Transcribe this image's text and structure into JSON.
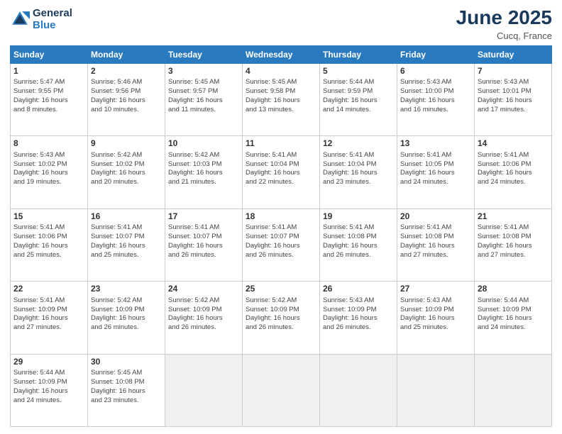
{
  "header": {
    "logo_line1": "General",
    "logo_line2": "Blue",
    "month": "June 2025",
    "location": "Cucq, France"
  },
  "days_of_week": [
    "Sunday",
    "Monday",
    "Tuesday",
    "Wednesday",
    "Thursday",
    "Friday",
    "Saturday"
  ],
  "weeks": [
    [
      {
        "day": "1",
        "info": "Sunrise: 5:47 AM\nSunset: 9:55 PM\nDaylight: 16 hours\nand 8 minutes."
      },
      {
        "day": "2",
        "info": "Sunrise: 5:46 AM\nSunset: 9:56 PM\nDaylight: 16 hours\nand 10 minutes."
      },
      {
        "day": "3",
        "info": "Sunrise: 5:45 AM\nSunset: 9:57 PM\nDaylight: 16 hours\nand 11 minutes."
      },
      {
        "day": "4",
        "info": "Sunrise: 5:45 AM\nSunset: 9:58 PM\nDaylight: 16 hours\nand 13 minutes."
      },
      {
        "day": "5",
        "info": "Sunrise: 5:44 AM\nSunset: 9:59 PM\nDaylight: 16 hours\nand 14 minutes."
      },
      {
        "day": "6",
        "info": "Sunrise: 5:43 AM\nSunset: 10:00 PM\nDaylight: 16 hours\nand 16 minutes."
      },
      {
        "day": "7",
        "info": "Sunrise: 5:43 AM\nSunset: 10:01 PM\nDaylight: 16 hours\nand 17 minutes."
      }
    ],
    [
      {
        "day": "8",
        "info": "Sunrise: 5:43 AM\nSunset: 10:02 PM\nDaylight: 16 hours\nand 19 minutes."
      },
      {
        "day": "9",
        "info": "Sunrise: 5:42 AM\nSunset: 10:02 PM\nDaylight: 16 hours\nand 20 minutes."
      },
      {
        "day": "10",
        "info": "Sunrise: 5:42 AM\nSunset: 10:03 PM\nDaylight: 16 hours\nand 21 minutes."
      },
      {
        "day": "11",
        "info": "Sunrise: 5:41 AM\nSunset: 10:04 PM\nDaylight: 16 hours\nand 22 minutes."
      },
      {
        "day": "12",
        "info": "Sunrise: 5:41 AM\nSunset: 10:04 PM\nDaylight: 16 hours\nand 23 minutes."
      },
      {
        "day": "13",
        "info": "Sunrise: 5:41 AM\nSunset: 10:05 PM\nDaylight: 16 hours\nand 24 minutes."
      },
      {
        "day": "14",
        "info": "Sunrise: 5:41 AM\nSunset: 10:06 PM\nDaylight: 16 hours\nand 24 minutes."
      }
    ],
    [
      {
        "day": "15",
        "info": "Sunrise: 5:41 AM\nSunset: 10:06 PM\nDaylight: 16 hours\nand 25 minutes."
      },
      {
        "day": "16",
        "info": "Sunrise: 5:41 AM\nSunset: 10:07 PM\nDaylight: 16 hours\nand 25 minutes."
      },
      {
        "day": "17",
        "info": "Sunrise: 5:41 AM\nSunset: 10:07 PM\nDaylight: 16 hours\nand 26 minutes."
      },
      {
        "day": "18",
        "info": "Sunrise: 5:41 AM\nSunset: 10:07 PM\nDaylight: 16 hours\nand 26 minutes."
      },
      {
        "day": "19",
        "info": "Sunrise: 5:41 AM\nSunset: 10:08 PM\nDaylight: 16 hours\nand 26 minutes."
      },
      {
        "day": "20",
        "info": "Sunrise: 5:41 AM\nSunset: 10:08 PM\nDaylight: 16 hours\nand 27 minutes."
      },
      {
        "day": "21",
        "info": "Sunrise: 5:41 AM\nSunset: 10:08 PM\nDaylight: 16 hours\nand 27 minutes."
      }
    ],
    [
      {
        "day": "22",
        "info": "Sunrise: 5:41 AM\nSunset: 10:09 PM\nDaylight: 16 hours\nand 27 minutes."
      },
      {
        "day": "23",
        "info": "Sunrise: 5:42 AM\nSunset: 10:09 PM\nDaylight: 16 hours\nand 26 minutes."
      },
      {
        "day": "24",
        "info": "Sunrise: 5:42 AM\nSunset: 10:09 PM\nDaylight: 16 hours\nand 26 minutes."
      },
      {
        "day": "25",
        "info": "Sunrise: 5:42 AM\nSunset: 10:09 PM\nDaylight: 16 hours\nand 26 minutes."
      },
      {
        "day": "26",
        "info": "Sunrise: 5:43 AM\nSunset: 10:09 PM\nDaylight: 16 hours\nand 26 minutes."
      },
      {
        "day": "27",
        "info": "Sunrise: 5:43 AM\nSunset: 10:09 PM\nDaylight: 16 hours\nand 25 minutes."
      },
      {
        "day": "28",
        "info": "Sunrise: 5:44 AM\nSunset: 10:09 PM\nDaylight: 16 hours\nand 24 minutes."
      }
    ],
    [
      {
        "day": "29",
        "info": "Sunrise: 5:44 AM\nSunset: 10:09 PM\nDaylight: 16 hours\nand 24 minutes."
      },
      {
        "day": "30",
        "info": "Sunrise: 5:45 AM\nSunset: 10:08 PM\nDaylight: 16 hours\nand 23 minutes."
      },
      {
        "day": "",
        "info": ""
      },
      {
        "day": "",
        "info": ""
      },
      {
        "day": "",
        "info": ""
      },
      {
        "day": "",
        "info": ""
      },
      {
        "day": "",
        "info": ""
      }
    ]
  ]
}
